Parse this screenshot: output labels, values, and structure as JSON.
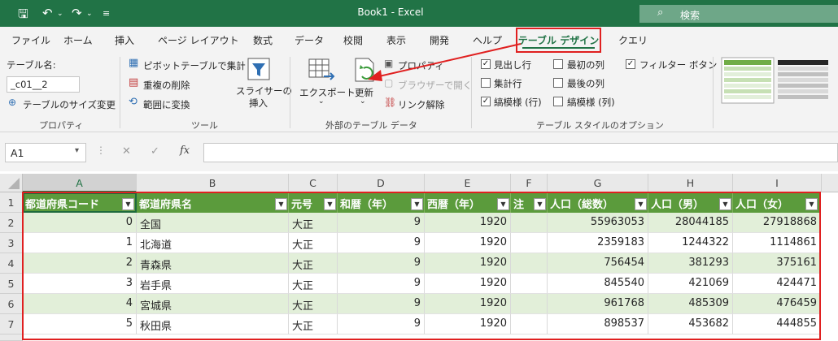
{
  "titlebar": {
    "title": "Book1  -  Excel",
    "search_placeholder": "検索"
  },
  "menu": {
    "tabs": [
      "ファイル",
      "ホーム",
      "挿入",
      "ページ レイアウト",
      "数式",
      "データ",
      "校閲",
      "表示",
      "開発",
      "ヘルプ",
      "テーブル デザイン",
      "クエリ"
    ]
  },
  "ribbon": {
    "properties": {
      "name_label": "テーブル名:",
      "name_value": "_c01__2",
      "resize_label": "テーブルのサイズ変更",
      "group": "プロパティ"
    },
    "tools": {
      "pivot": "ピボットテーブルで集計",
      "dup": "重複の削除",
      "convert": "範囲に変換",
      "slicer_1": "スライサーの",
      "slicer_2": "挿入",
      "group": "ツール"
    },
    "external": {
      "export": "エクスポート",
      "refresh": "更新",
      "props": "プロパティ",
      "browser": "ブラウザーで開く",
      "unlink": "リンク解除",
      "group": "外部のテーブル データ"
    },
    "options": {
      "header_row": "見出し行",
      "total_row": "集計行",
      "banded_rows": "縞模様 (行)",
      "first_col": "最初の列",
      "last_col": "最後の列",
      "banded_cols": "縞模様 (列)",
      "filter_btn": "フィルター ボタン",
      "group": "テーブル スタイルのオプション",
      "checked": {
        "header_row": true,
        "total_row": false,
        "banded_rows": true,
        "first_col": false,
        "last_col": false,
        "banded_cols": false,
        "filter_btn": true
      }
    }
  },
  "formula": {
    "namebox": "A1",
    "value": ""
  },
  "grid": {
    "columns": [
      "A",
      "B",
      "C",
      "D",
      "E",
      "F",
      "G",
      "H",
      "I"
    ],
    "rows": [
      "1",
      "2",
      "3",
      "4",
      "5",
      "6",
      "7"
    ],
    "headers": [
      "都道府県コード",
      "都道府県名",
      "元号",
      "和暦（年）",
      "西暦（年）",
      "注",
      "人口（総数）",
      "人口（男）",
      "人口（女）"
    ],
    "data": [
      [
        "0",
        "全国",
        "大正",
        "9",
        "1920",
        "",
        "55963053",
        "28044185",
        "27918868"
      ],
      [
        "1",
        "北海道",
        "大正",
        "9",
        "1920",
        "",
        "2359183",
        "1244322",
        "1114861"
      ],
      [
        "2",
        "青森県",
        "大正",
        "9",
        "1920",
        "",
        "756454",
        "381293",
        "375161"
      ],
      [
        "3",
        "岩手県",
        "大正",
        "9",
        "1920",
        "",
        "845540",
        "421069",
        "424471"
      ],
      [
        "4",
        "宮城県",
        "大正",
        "9",
        "1920",
        "",
        "961768",
        "485309",
        "476459"
      ],
      [
        "5",
        "秋田県",
        "大正",
        "9",
        "1920",
        "",
        "898537",
        "453682",
        "444855"
      ]
    ]
  }
}
